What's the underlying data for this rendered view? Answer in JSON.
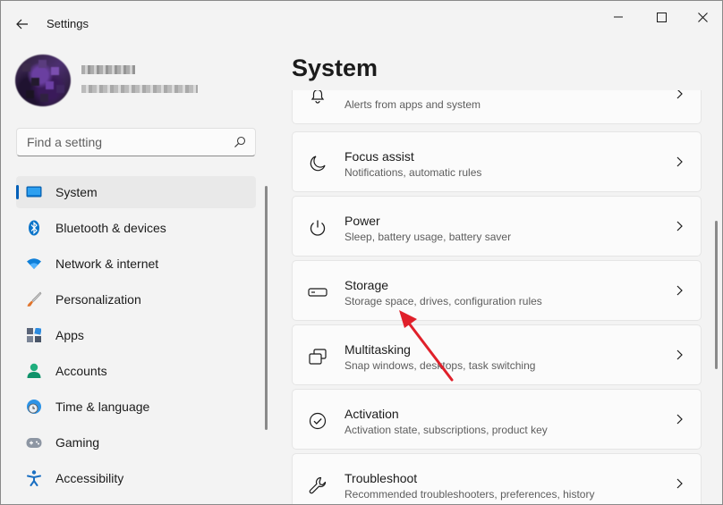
{
  "window": {
    "title": "Settings"
  },
  "profile": {
    "name": "",
    "email": ""
  },
  "search": {
    "placeholder": "Find a setting",
    "value": ""
  },
  "sidebar": {
    "items": [
      {
        "label": "System",
        "icon": "monitor-icon",
        "selected": true
      },
      {
        "label": "Bluetooth & devices",
        "icon": "bluetooth-icon",
        "selected": false
      },
      {
        "label": "Network & internet",
        "icon": "wifi-icon",
        "selected": false
      },
      {
        "label": "Personalization",
        "icon": "brush-icon",
        "selected": false
      },
      {
        "label": "Apps",
        "icon": "apps-icon",
        "selected": false
      },
      {
        "label": "Accounts",
        "icon": "person-icon",
        "selected": false
      },
      {
        "label": "Time & language",
        "icon": "globe-clock-icon",
        "selected": false
      },
      {
        "label": "Gaming",
        "icon": "gamepad-icon",
        "selected": false
      },
      {
        "label": "Accessibility",
        "icon": "accessibility-icon",
        "selected": false
      }
    ]
  },
  "main": {
    "title": "System",
    "cards": [
      {
        "title": "",
        "desc": "Alerts from apps and system",
        "icon": "bell-icon"
      },
      {
        "title": "Focus assist",
        "desc": "Notifications, automatic rules",
        "icon": "moon-icon"
      },
      {
        "title": "Power",
        "desc": "Sleep, battery usage, battery saver",
        "icon": "power-icon"
      },
      {
        "title": "Storage",
        "desc": "Storage space, drives, configuration rules",
        "icon": "storage-drive-icon"
      },
      {
        "title": "Multitasking",
        "desc": "Snap windows, desktops, task switching",
        "icon": "multitask-windows-icon"
      },
      {
        "title": "Activation",
        "desc": "Activation state, subscriptions, product key",
        "icon": "check-circle-icon"
      },
      {
        "title": "Troubleshoot",
        "desc": "Recommended troubleshooters, preferences, history",
        "icon": "wrench-icon"
      }
    ]
  },
  "colors": {
    "accent": "#005fb8",
    "annotation_arrow": "#e0202a"
  }
}
